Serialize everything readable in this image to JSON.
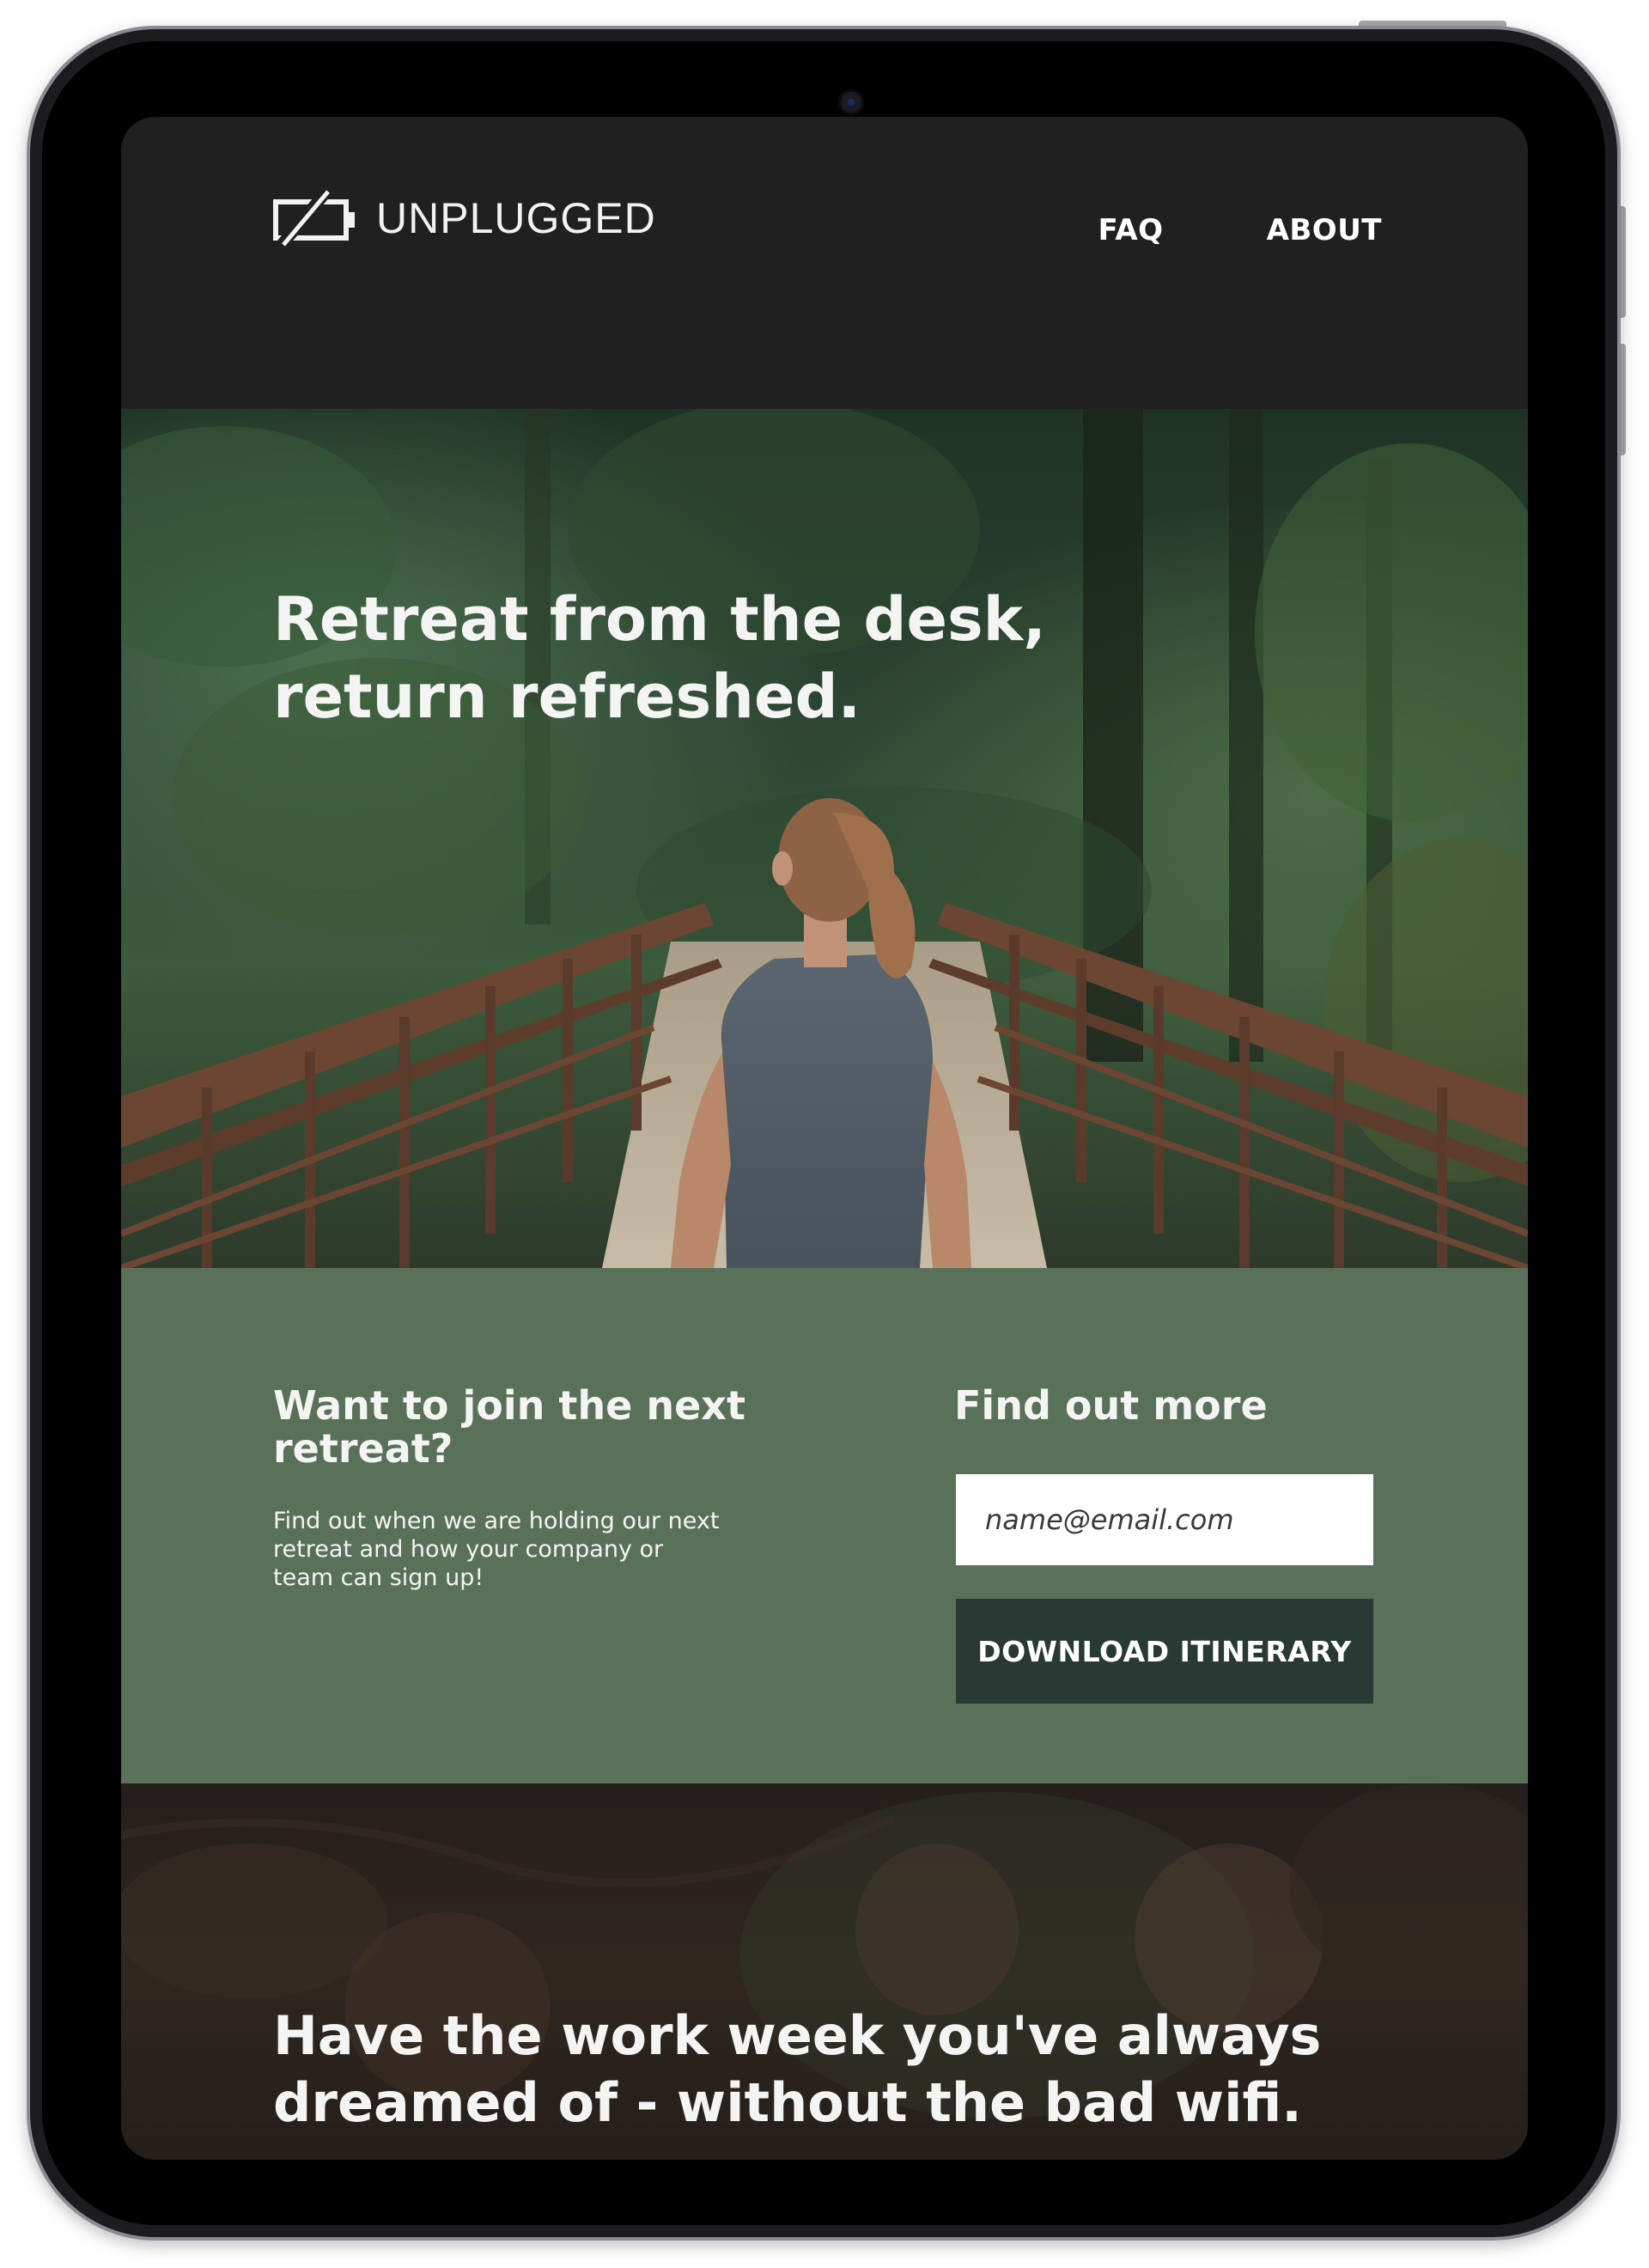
{
  "header": {
    "brand": "UNPLUGGED",
    "logo_icon": "dead-battery-icon",
    "nav": [
      {
        "label": "FAQ"
      },
      {
        "label": "ABOUT"
      }
    ]
  },
  "hero": {
    "title": "Retreat from the desk, return refreshed.",
    "image": "woman-on-forest-bridge-photo"
  },
  "signup": {
    "title": "Want to join the next retreat?",
    "body": "Find out when we are holding our next retreat and how your company or team can sign up!",
    "more_title": "Find out more",
    "email_placeholder": "name@email.com",
    "button_label": "DOWNLOAD ITINERARY"
  },
  "bottom": {
    "title": "Have the work week you've always dreamed of - without the bad wifi.",
    "image": "people-sitting-on-forest-floor-photo"
  },
  "colors": {
    "header_bg": "#1f201f",
    "signup_bg": "#5a7159",
    "button_bg": "#283a33",
    "text_light": "#f4f4f2"
  }
}
